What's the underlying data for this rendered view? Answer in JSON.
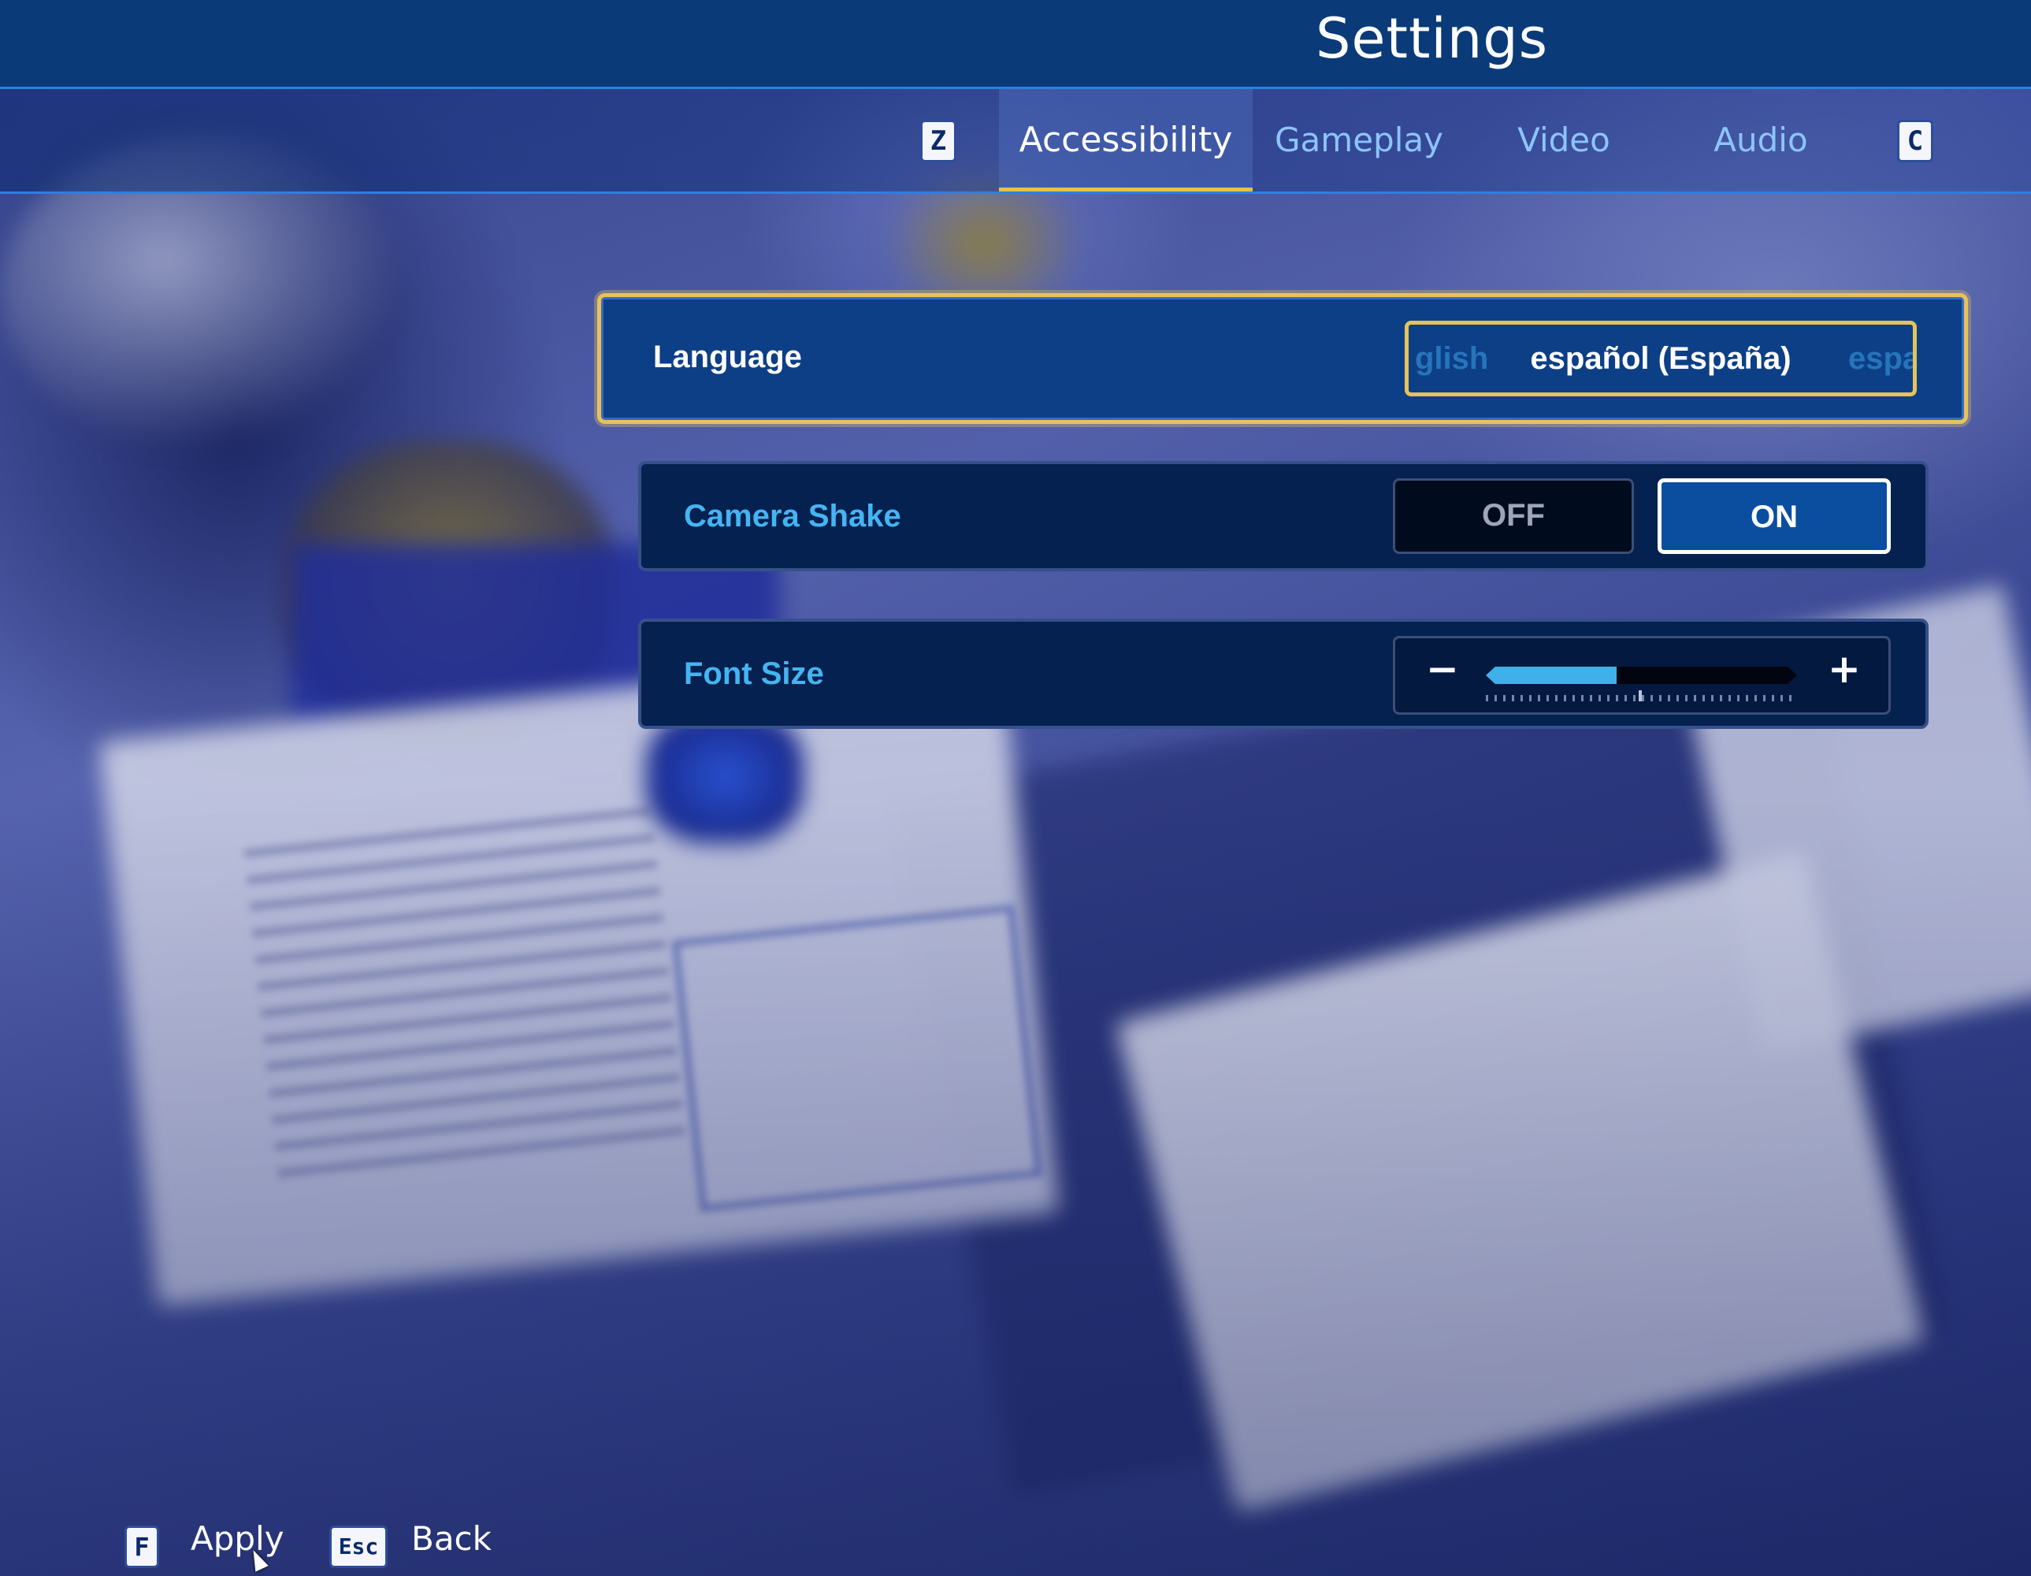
{
  "header": {
    "title": "Settings"
  },
  "tabs": {
    "prev_key": "Z",
    "next_key": "C",
    "items": [
      {
        "label": "Accessibility",
        "active": true
      },
      {
        "label": "Gameplay",
        "active": false
      },
      {
        "label": "Video",
        "active": false
      },
      {
        "label": "Audio",
        "active": false
      }
    ]
  },
  "settings": {
    "language": {
      "label": "Language",
      "prev_option_partial": "glish",
      "current": "español (España)",
      "next_option_partial": "espa"
    },
    "camera_shake": {
      "label": "Camera Shake",
      "off_label": "OFF",
      "on_label": "ON",
      "selected": "ON"
    },
    "font_size": {
      "label": "Font Size",
      "minus_symbol": "−",
      "plus_symbol": "+",
      "level": 0.42
    }
  },
  "footer": {
    "apply_key": "F",
    "apply_label": "Apply",
    "back_key": "Esc",
    "back_label": "Back"
  },
  "colors": {
    "header_bg": "#0a3b78",
    "accent_gold": "#e6c35a",
    "accent_blue": "#45b4f2",
    "row_bg": "#04214f"
  }
}
